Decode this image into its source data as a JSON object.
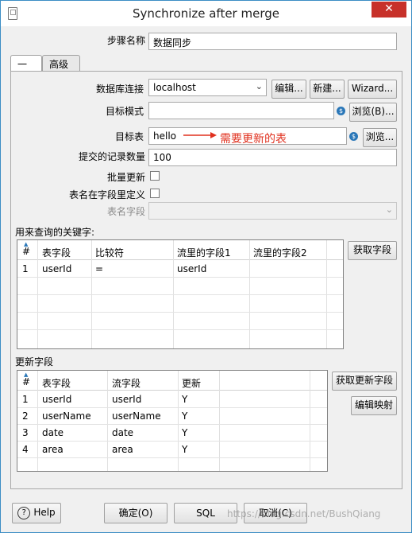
{
  "window": {
    "title": "Synchronize after merge",
    "close_glyph": "✕"
  },
  "step": {
    "label": "步骤名称",
    "value": "数据同步"
  },
  "tabs": [
    {
      "label": "一般"
    },
    {
      "label": "高级"
    }
  ],
  "form": {
    "db_label": "数据库连接",
    "db_value": "localhost",
    "edit_btn": "编辑...",
    "new_btn": "新建...",
    "wizard_btn": "Wizard...",
    "schema_label": "目标模式",
    "schema_value": "",
    "browse_b_btn": "浏览(B)...",
    "table_label": "目标表",
    "table_value": "hello",
    "browse_btn": "浏览...",
    "annotation": "需要更新的表",
    "commit_label": "提交的记录数量",
    "commit_value": "100",
    "batch_label": "批量更新",
    "tablename_in_field_label": "表名在字段里定义",
    "tablename_field_label": "表名字段",
    "tablename_field_value": ""
  },
  "keys": {
    "title": "用来查询的关键字:",
    "get_btn": "获取字段",
    "headers": [
      "#",
      "表字段",
      "比较符",
      "流里的字段1",
      "流里的字段2"
    ],
    "rows": [
      [
        "1",
        "userId",
        "=",
        "userId",
        ""
      ]
    ]
  },
  "updates": {
    "title": "更新字段",
    "get_btn": "获取更新字段",
    "map_btn": "编辑映射",
    "headers": [
      "#",
      "表字段",
      "流字段",
      "更新"
    ],
    "rows": [
      [
        "1",
        "userId",
        "userId",
        "Y"
      ],
      [
        "2",
        "userName",
        "userName",
        "Y"
      ],
      [
        "3",
        "date",
        "date",
        "Y"
      ],
      [
        "4",
        "area",
        "area",
        "Y"
      ]
    ]
  },
  "footer": {
    "help": "Help",
    "ok": "确定(O)",
    "sql": "SQL",
    "cancel": "取消(C)",
    "watermark": "https://blog.csdn.net/BushQiang"
  },
  "colors": {
    "annotation": "#e0301e",
    "accent": "#2a77b8"
  }
}
